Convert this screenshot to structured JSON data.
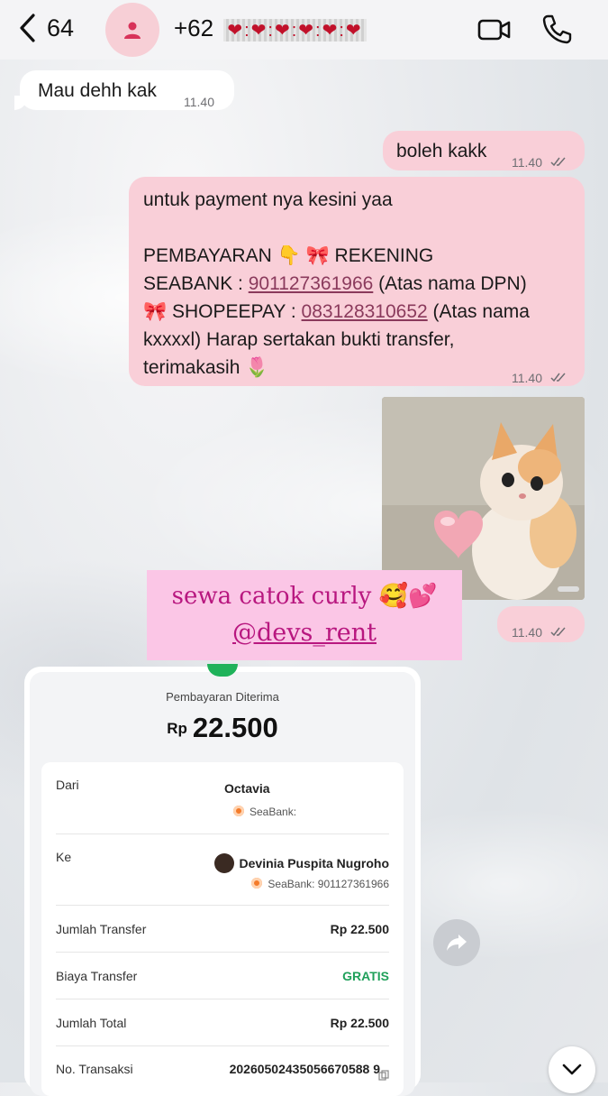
{
  "header": {
    "back_count": "64",
    "contact_prefix": "+62",
    "contact_masked": "❤:❤:❤:❤:❤:❤"
  },
  "messages": [
    {
      "dir": "in",
      "text": "Mau dehh kak",
      "time": "11.40"
    },
    {
      "dir": "out",
      "text": "boleh kakk",
      "time": "11.40"
    },
    {
      "dir": "out",
      "time": "11.40",
      "lines": {
        "l1": "untuk payment nya kesini yaa",
        "l2": "PEMBAYARAN 👇  🎀 REKENING",
        "l3a": "SEABANK : ",
        "l3link": "901127361966",
        "l3b": " (Atas nama DPN)",
        "l4a": "🎀 SHOPEEPAY : ",
        "l4link": "083128310652",
        "l4b": " (Atas nama",
        "l5": "kxxxxl)  Harap sertakan bukti transfer,",
        "l6": "terimakasih 🌷"
      }
    },
    {
      "dir": "out",
      "type": "image",
      "time": "11.40"
    }
  ],
  "promo": {
    "line1": "sewa catok curly 🥰💕",
    "line2": "@devs_rent"
  },
  "receipt": {
    "title": "Pembayaran Diterima",
    "currency": "Rp",
    "amount": "22.500",
    "rows": {
      "dari_label": "Dari",
      "dari_name": "Octavia",
      "dari_bank": "SeaBank:",
      "ke_label": "Ke",
      "ke_name": "Devinia Puspita Nugroho",
      "ke_bank": "SeaBank: 901127361966",
      "jumlah_label": "Jumlah Transfer",
      "jumlah_val": "Rp 22.500",
      "biaya_label": "Biaya Transfer",
      "biaya_val": "GRATIS",
      "total_label": "Jumlah Total",
      "total_val": "Rp 22.500",
      "trx_label": "No. Transaksi",
      "trx_val": "20260502435056670588 9"
    }
  },
  "colors": {
    "bubble_out": "#f9cfd8",
    "bubble_in": "#ffffff",
    "promo_bg": "#fbc6e6",
    "promo_text": "#b8177f",
    "gratis": "#1fa05a"
  },
  "icons": [
    "chevron-left-icon",
    "person-icon",
    "video-camera-icon",
    "phone-icon",
    "double-check-icon",
    "forward-icon",
    "chevron-down-icon",
    "copy-icon"
  ]
}
